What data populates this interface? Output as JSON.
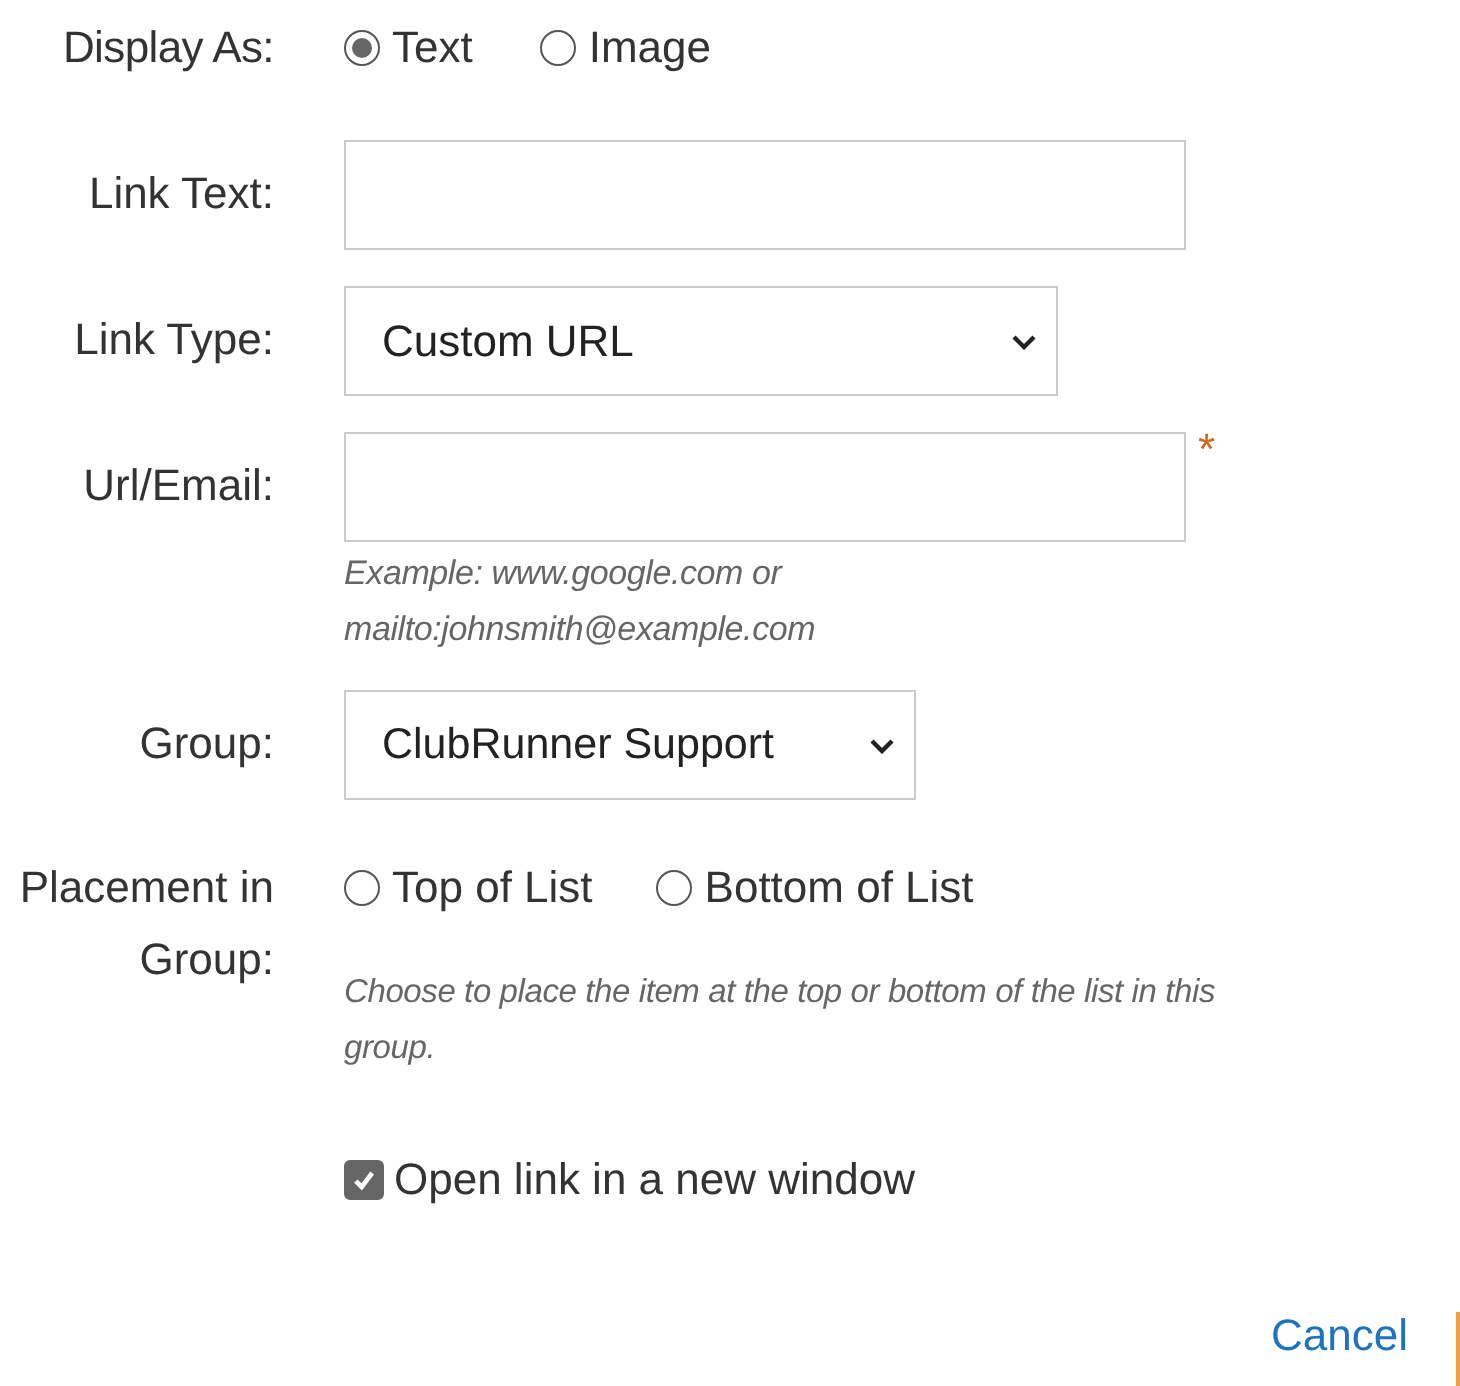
{
  "display_as": {
    "label": "Display As:",
    "options": [
      {
        "label": "Text",
        "selected": true
      },
      {
        "label": "Image",
        "selected": false
      }
    ]
  },
  "link_text": {
    "label": "Link Text:"
  },
  "link_type": {
    "label": "Link Type:",
    "value": "Custom URL"
  },
  "url_email": {
    "label": "Url/Email:",
    "required_mark": "*",
    "hint_lines": [
      "Example: www.google.com or",
      "mailto:johnsmith@example.com"
    ]
  },
  "group": {
    "label": "Group:",
    "value": "ClubRunner Support"
  },
  "placement": {
    "label_lines": [
      "Placement in",
      "Group:"
    ],
    "options": [
      {
        "label": "Top of List",
        "selected": false
      },
      {
        "label": "Bottom of List",
        "selected": false
      }
    ],
    "hint_lines": [
      "Choose to place the item at the top or bottom of the list in this",
      "group."
    ]
  },
  "new_window": {
    "label": "Open link in a new window",
    "checked": true
  },
  "buttons": [
    {
      "label": "Cancel"
    }
  ]
}
